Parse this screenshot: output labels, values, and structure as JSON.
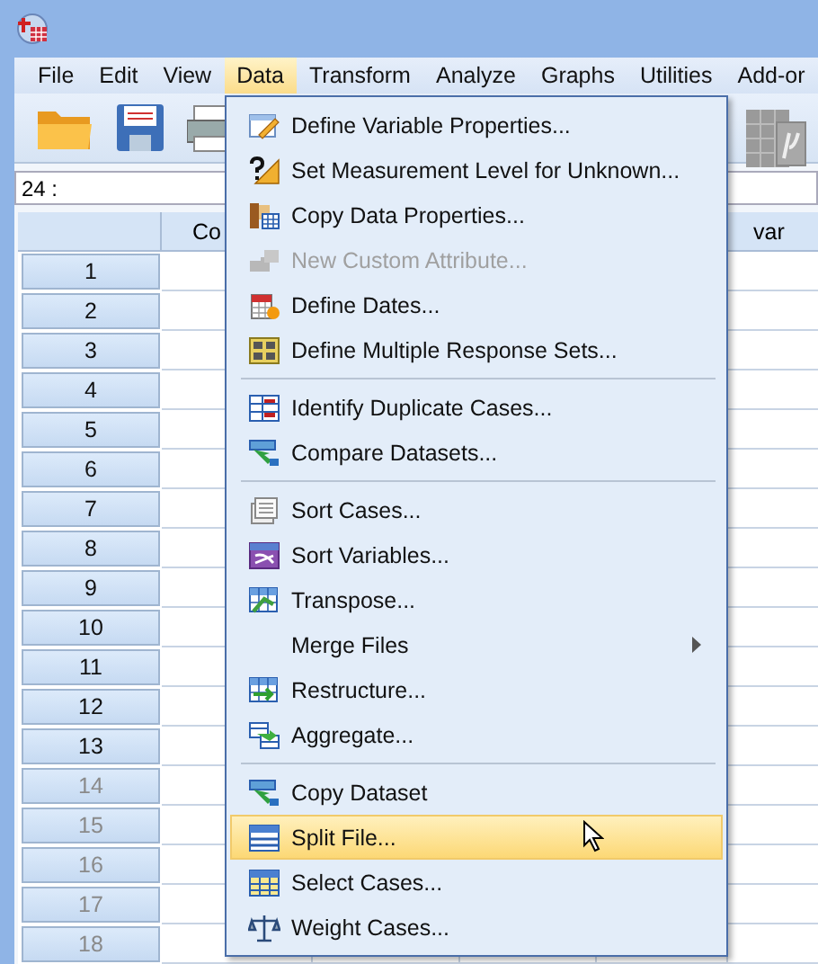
{
  "menubar": [
    {
      "label": "File",
      "selected": false
    },
    {
      "label": "Edit",
      "selected": false
    },
    {
      "label": "View",
      "selected": false
    },
    {
      "label": "Data",
      "selected": true
    },
    {
      "label": "Transform",
      "selected": false
    },
    {
      "label": "Analyze",
      "selected": false
    },
    {
      "label": "Graphs",
      "selected": false
    },
    {
      "label": "Utilities",
      "selected": false
    },
    {
      "label": "Add-or",
      "selected": false
    }
  ],
  "cell_reference": "24 :",
  "grid": {
    "columns": [
      {
        "header": "Co"
      },
      {
        "header": "var"
      }
    ],
    "rows": [
      {
        "number": "1",
        "greyed": false
      },
      {
        "number": "2",
        "greyed": false
      },
      {
        "number": "3",
        "greyed": false
      },
      {
        "number": "4",
        "greyed": false
      },
      {
        "number": "5",
        "greyed": false
      },
      {
        "number": "6",
        "greyed": false
      },
      {
        "number": "7",
        "greyed": false
      },
      {
        "number": "8",
        "greyed": false
      },
      {
        "number": "9",
        "greyed": false
      },
      {
        "number": "10",
        "greyed": false
      },
      {
        "number": "11",
        "greyed": false
      },
      {
        "number": "12",
        "greyed": false
      },
      {
        "number": "13",
        "greyed": false
      },
      {
        "number": "14",
        "greyed": true
      },
      {
        "number": "15",
        "greyed": true
      },
      {
        "number": "16",
        "greyed": true
      },
      {
        "number": "17",
        "greyed": true
      },
      {
        "number": "18",
        "greyed": true
      }
    ]
  },
  "data_menu": [
    {
      "label": "Define Variable Properties...",
      "kind": "command",
      "disabled": false,
      "selected": false
    },
    {
      "label": "Set Measurement Level for Unknown...",
      "kind": "command",
      "disabled": false,
      "selected": false
    },
    {
      "label": "Copy Data Properties...",
      "kind": "command",
      "disabled": false,
      "selected": false
    },
    {
      "label": "New Custom Attribute...",
      "kind": "command",
      "disabled": true,
      "selected": false
    },
    {
      "label": "Define Dates...",
      "kind": "command",
      "disabled": false,
      "selected": false
    },
    {
      "label": "Define Multiple Response Sets...",
      "kind": "command",
      "disabled": false,
      "selected": false
    },
    {
      "kind": "separator"
    },
    {
      "label": "Identify Duplicate Cases...",
      "kind": "command",
      "disabled": false,
      "selected": false
    },
    {
      "label": "Compare Datasets...",
      "kind": "command",
      "disabled": false,
      "selected": false
    },
    {
      "kind": "separator"
    },
    {
      "label": "Sort Cases...",
      "kind": "command",
      "disabled": false,
      "selected": false
    },
    {
      "label": "Sort Variables...",
      "kind": "command",
      "disabled": false,
      "selected": false
    },
    {
      "label": "Transpose...",
      "kind": "command",
      "disabled": false,
      "selected": false
    },
    {
      "label": "Merge Files",
      "kind": "submenu",
      "disabled": false,
      "selected": false
    },
    {
      "label": "Restructure...",
      "kind": "command",
      "disabled": false,
      "selected": false
    },
    {
      "label": "Aggregate...",
      "kind": "command",
      "disabled": false,
      "selected": false
    },
    {
      "kind": "separator"
    },
    {
      "label": "Copy Dataset",
      "kind": "command",
      "disabled": false,
      "selected": false
    },
    {
      "label": "Split File...",
      "kind": "command",
      "disabled": false,
      "selected": true
    },
    {
      "label": "Select Cases...",
      "kind": "command",
      "disabled": false,
      "selected": false
    },
    {
      "label": "Weight Cases...",
      "kind": "command",
      "disabled": false,
      "selected": false
    }
  ]
}
